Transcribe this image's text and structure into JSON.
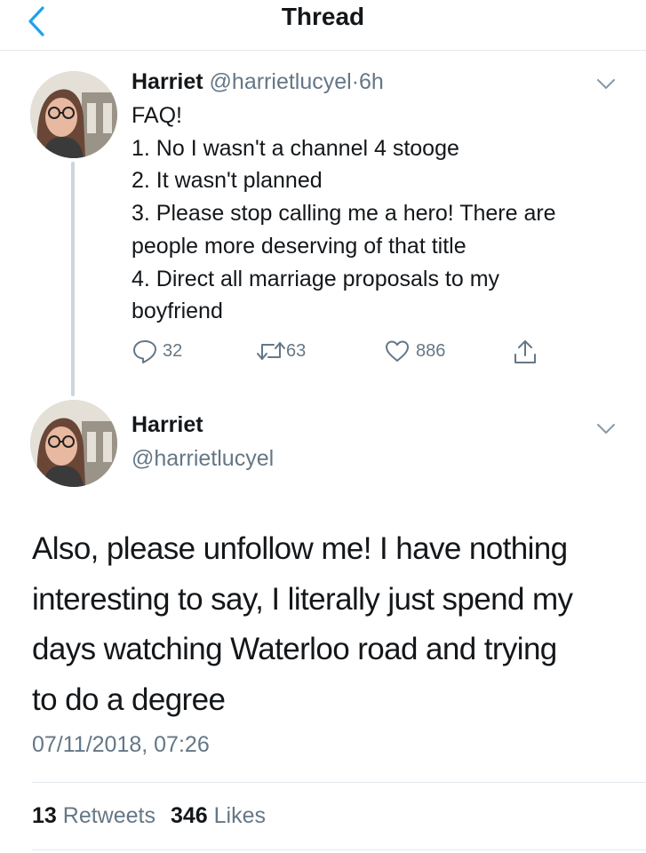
{
  "nav": {
    "title": "Thread"
  },
  "tweet1": {
    "name": "Harriet",
    "handle": "@harrietlucyel",
    "separator": "·",
    "time": "6h",
    "lines": [
      "FAQ!",
      "1. No I wasn't a channel 4 stooge",
      "2. It wasn't planned",
      "3. Please stop calling me a hero! There are",
      "people more deserving of that title",
      "4. Direct all marriage proposals to my",
      "boyfriend"
    ],
    "replies": "32",
    "retweets": "63",
    "likes": "886",
    "icons": [
      "reply-icon",
      "retweet-icon",
      "like-icon",
      "share-icon",
      "chevron-down-icon"
    ]
  },
  "tweet2": {
    "name": "Harriet",
    "handle": "@harrietlucyel",
    "lines": [
      "Also, please unfollow me! I have nothing",
      "interesting to say, I literally just spend my",
      "days watching Waterloo road and trying",
      "to do a degree"
    ],
    "timestamp": "07/11/2018, 07:26",
    "retweet_count": "13",
    "retweet_label": "Retweets",
    "like_count": "346",
    "like_label": "Likes"
  },
  "colors": {
    "accent": "#1da1f2",
    "text": "#14171a",
    "muted": "#657786",
    "divider": "#e1e8ed"
  }
}
